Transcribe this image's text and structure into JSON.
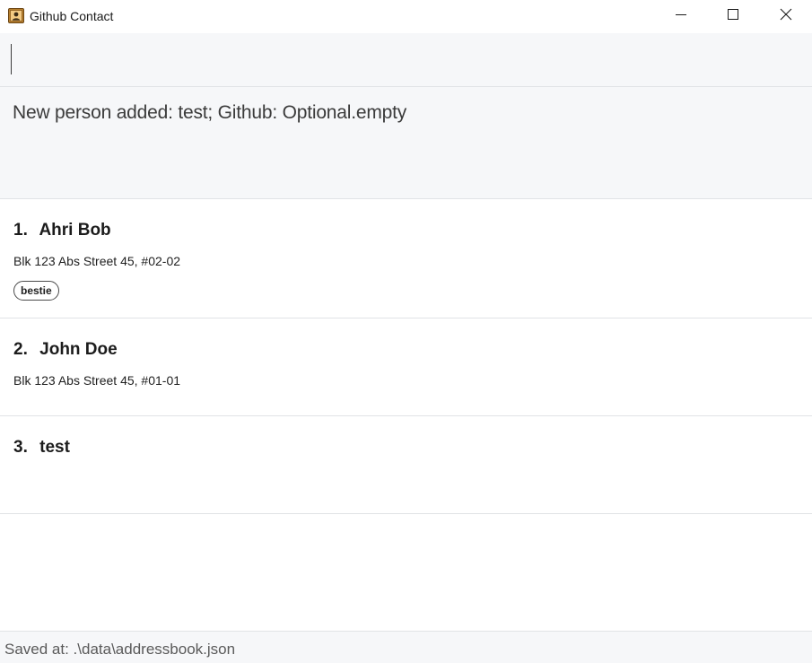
{
  "window": {
    "title": "Github Contact",
    "app_icon": "contact-book-icon",
    "controls": [
      "minimize-icon",
      "maximize-icon",
      "close-icon"
    ]
  },
  "command_box": {
    "value": "",
    "placeholder": ""
  },
  "result_display": {
    "text": "New person added: test; Github: Optional.empty"
  },
  "persons": [
    {
      "index": "1.",
      "name": "Ahri Bob",
      "address": "Blk 123 Abs Street 45, #02-02",
      "tags": [
        "bestie"
      ]
    },
    {
      "index": "2.",
      "name": "John Doe",
      "address": "Blk 123 Abs Street 45, #01-01",
      "tags": []
    },
    {
      "index": "3.",
      "name": "test",
      "address": "",
      "tags": []
    }
  ],
  "status_bar": {
    "text": "Saved at: .\\data\\addressbook.json"
  },
  "colors": {
    "panel_background": "#f6f7f9",
    "divider": "#e1e3e6",
    "text_primary": "#1c1c1c",
    "text_secondary": "#5a5a5a"
  }
}
